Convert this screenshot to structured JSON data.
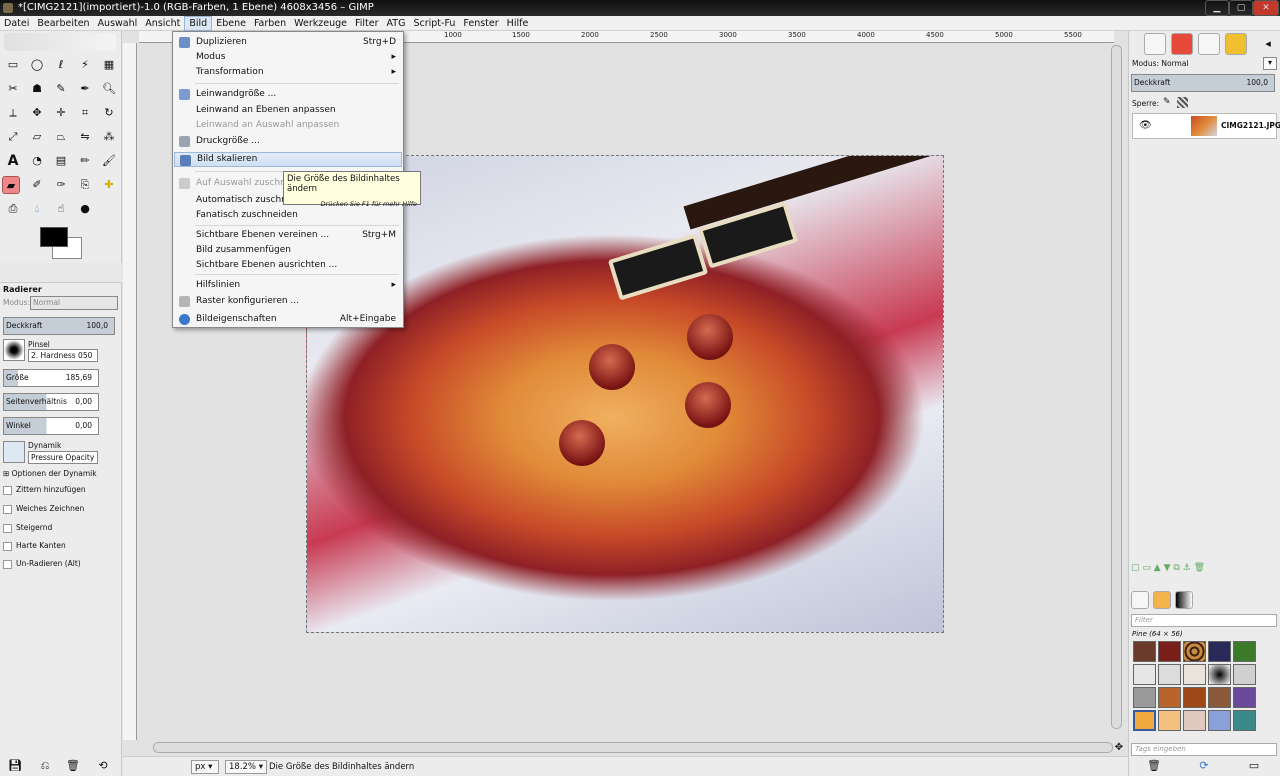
{
  "window": {
    "title": "*[CIMG2121](importiert)-1.0 (RGB-Farben, 1 Ebene) 4608x3456 – GIMP"
  },
  "menubar": [
    "Datei",
    "Bearbeiten",
    "Auswahl",
    "Ansicht",
    "Bild",
    "Ebene",
    "Farben",
    "Werkzeuge",
    "Filter",
    "ATG",
    "Script-Fu",
    "Fenster",
    "Hilfe"
  ],
  "menu_active": "Bild",
  "dropdown": {
    "items": [
      {
        "label": "Duplizieren",
        "accel": "Strg+D",
        "sub": false,
        "disabled": false
      },
      {
        "label": "Modus",
        "accel": "",
        "sub": true,
        "disabled": false
      },
      {
        "label": "Transformation",
        "accel": "",
        "sub": true,
        "disabled": false
      },
      {
        "label": "Leinwandgröße ...",
        "accel": "",
        "sub": false,
        "disabled": false
      },
      {
        "label": "Leinwand an Ebenen anpassen",
        "accel": "",
        "sub": false,
        "disabled": false
      },
      {
        "label": "Leinwand an Auswahl anpassen",
        "accel": "",
        "sub": false,
        "disabled": true
      },
      {
        "label": "Druckgröße ...",
        "accel": "",
        "sub": false,
        "disabled": false
      },
      {
        "label": "Bild skalieren",
        "accel": "",
        "sub": false,
        "disabled": false,
        "highlighted": true
      },
      {
        "label": "Auf Auswahl zuschneiden",
        "accel": "",
        "sub": false,
        "disabled": true
      },
      {
        "label": "Automatisch zuschneiden",
        "accel": "",
        "sub": false,
        "disabled": false
      },
      {
        "label": "Fanatisch zuschneiden",
        "accel": "",
        "sub": false,
        "disabled": false
      },
      {
        "label": "Sichtbare Ebenen vereinen ...",
        "accel": "Strg+M",
        "sub": false,
        "disabled": false
      },
      {
        "label": "Bild zusammenfügen",
        "accel": "",
        "sub": false,
        "disabled": false
      },
      {
        "label": "Sichtbare Ebenen ausrichten ...",
        "accel": "",
        "sub": false,
        "disabled": false
      },
      {
        "label": "Hilfslinien",
        "accel": "",
        "sub": true,
        "disabled": false
      },
      {
        "label": "Raster konfigurieren ...",
        "accel": "",
        "sub": false,
        "disabled": false
      },
      {
        "label": "Bildeigenschaften",
        "accel": "Alt+Eingabe",
        "sub": false,
        "disabled": false
      }
    ]
  },
  "tooltip": {
    "text": "Die Größe des Bildinhaltes ändern",
    "hint": "Drücken Sie F1 für mehr Hilfe"
  },
  "tool_options": {
    "title": "Radierer",
    "mode_label": "Modus:",
    "mode_value": "Normal",
    "opacity_label": "Deckkraft",
    "opacity_value": "100,0",
    "brush_label": "Pinsel",
    "brush_value": "2. Hardness 050",
    "size_label": "Größe",
    "size_value": "185,69",
    "aspect_label": "Seitenverhältnis",
    "aspect_value": "0,00",
    "angle_label": "Winkel",
    "angle_value": "0,00",
    "dynamics_label": "Dynamik",
    "dynamics_value": "Pressure Opacity",
    "dynamics_options": "Optionen der Dynamik",
    "checkboxes": [
      "Zittern hinzufügen",
      "Weiches Zeichnen",
      "Steigernd",
      "Harte Kanten",
      "Un-Radieren (Alt)"
    ]
  },
  "ruler_labels": [
    "1000",
    "1500",
    "2000",
    "2500",
    "3000",
    "3500",
    "4000",
    "4500",
    "5000",
    "5500"
  ],
  "statusbar": {
    "unit": "px",
    "zoom": "18.2%",
    "message": "Die Größe des Bildinhaltes ändern"
  },
  "layers": {
    "mode_label": "Modus:",
    "mode_value": "Normal",
    "opacity_label": "Deckkraft",
    "opacity_value": "100,0",
    "lock_label": "Sperre:",
    "layer_name": "CIMG2121.JPG"
  },
  "patterns": {
    "filter_placeholder": "Filter",
    "name": "Pine (64 × 56)",
    "tags_placeholder": "Tags eingeben"
  },
  "colors": {
    "accent": "#9cb8dd",
    "fg": "#000000",
    "bg": "#ffffff"
  }
}
